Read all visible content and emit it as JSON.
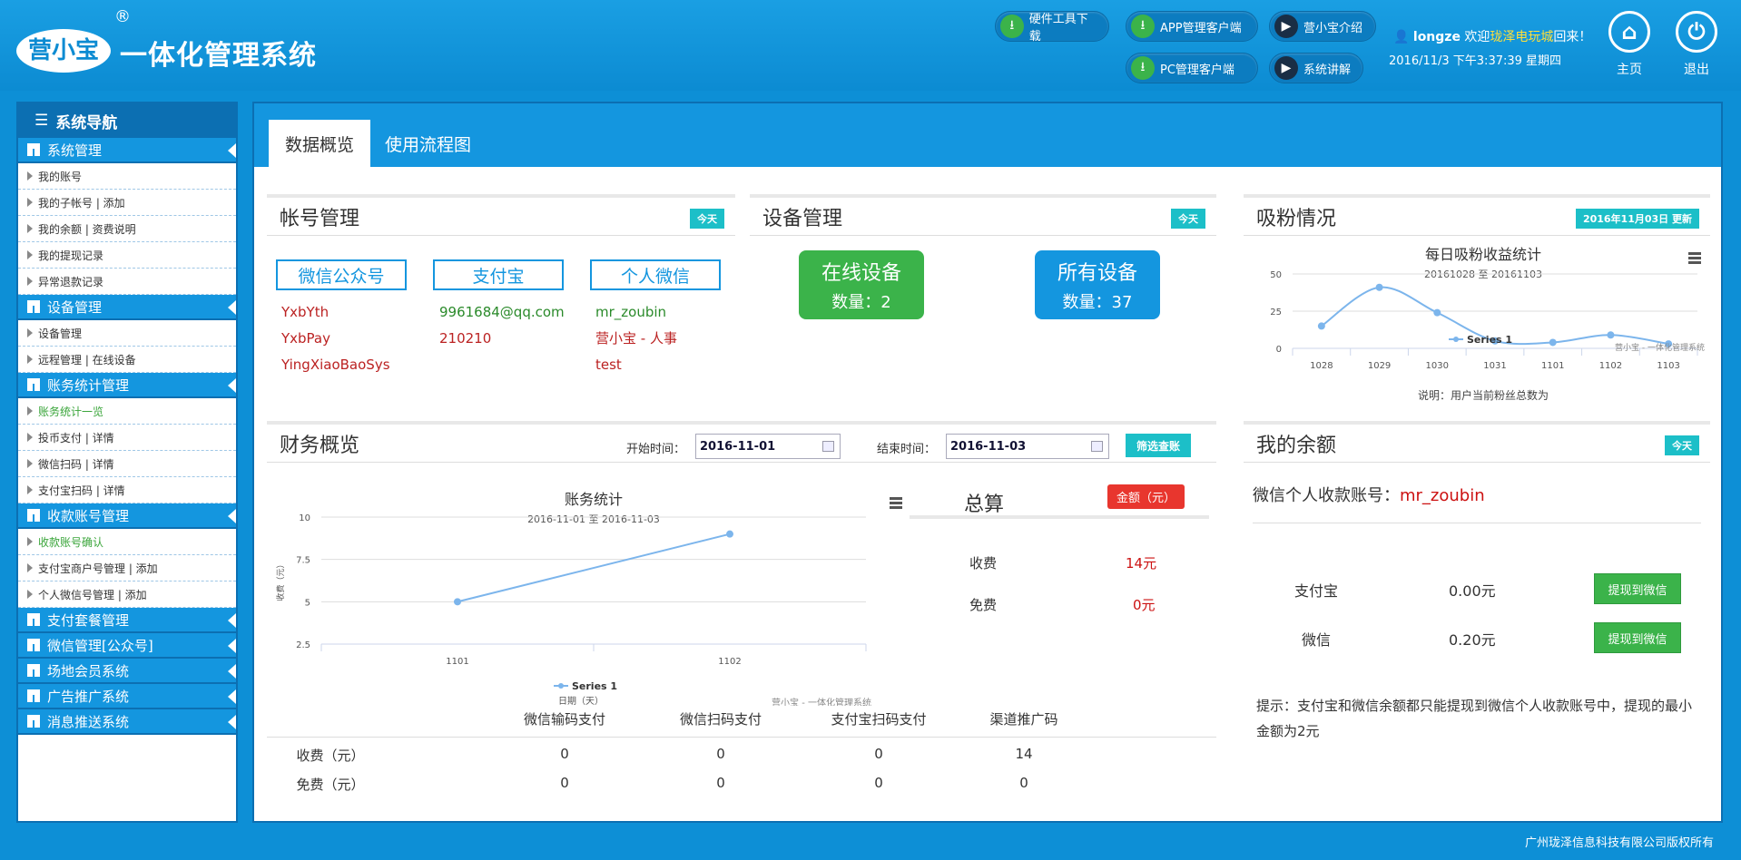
{
  "header": {
    "logo_text": "营小宝",
    "registered_mark": "®",
    "app_title": "一体化管理系统",
    "buttons": [
      {
        "label": "硬件工具下载",
        "icon": "download-icon"
      },
      {
        "label": "APP管理客户端",
        "icon": "download-icon"
      },
      {
        "label": "营小宝介绍",
        "icon": "play-icon"
      },
      {
        "label": "PC管理客户端",
        "icon": "download-icon"
      },
      {
        "label": "系统讲解",
        "icon": "play-icon"
      }
    ],
    "username": "longze",
    "welcome_prefix": "欢迎",
    "shop_name": "珑泽电玩城",
    "welcome_suffix": "回来！",
    "datetime": "2016/11/3 下午3:37:39 星期四",
    "home_label": "主页",
    "logout_label": "退出"
  },
  "sidebar": {
    "title": "系统导航",
    "sections": [
      {
        "label": "系统管理",
        "items": [
          "我的账号",
          "我的子帐号 | 添加",
          "我的余额 | 资费说明",
          "我的提现记录",
          "异常退款记录"
        ]
      },
      {
        "label": "设备管理",
        "items": [
          "设备管理",
          "远程管理 | 在线设备"
        ]
      },
      {
        "label": "账务统计管理",
        "items": [
          "账务统计一览",
          "投币支付 | 详情",
          "微信扫码 | 详情",
          "支付宝扫码 | 详情"
        ]
      },
      {
        "label": "收款账号管理",
        "items": [
          "收款账号确认",
          "支付宝商户号管理 | 添加",
          "个人微信号管理 | 添加"
        ]
      },
      {
        "label": "支付套餐管理",
        "items": []
      },
      {
        "label": "微信管理[公众号]",
        "items": []
      },
      {
        "label": "场地会员系统",
        "items": []
      },
      {
        "label": "广告推广系统",
        "items": []
      },
      {
        "label": "消息推送系统",
        "items": []
      }
    ]
  },
  "tabs": [
    "数据概览",
    "使用流程图"
  ],
  "account_panel": {
    "title": "帐号管理",
    "badge": "今天",
    "columns": [
      "微信公众号",
      "支付宝",
      "个人微信"
    ],
    "wechat_public": [
      "YxbYth",
      "YxbPay",
      "YingXiaoBaoSys"
    ],
    "alipay": [
      "9961684@qq.com",
      "210210"
    ],
    "personal_wechat": [
      "mr_zoubin",
      "营小宝 - 人事",
      "test"
    ]
  },
  "device_panel": {
    "title": "设备管理",
    "badge": "今天",
    "online_label": "在线设备",
    "online_count": "数量：2",
    "all_label": "所有设备",
    "all_count": "数量：37"
  },
  "fans_panel": {
    "title": "吸粉情况",
    "badge": "2016年11月03日 更新",
    "chart_title": "每日吸粉收益统计",
    "chart_subtitle": "20161028 至 20161103",
    "credit": "营小宝 - 一体化管理系统",
    "note": "说明：用户当前粉丝总数为"
  },
  "finance_panel": {
    "title": "财务概览",
    "start_label": "开始时间：",
    "start_value": "2016-11-01",
    "end_label": "结束时间：",
    "end_value": "2016-11-03",
    "filter_button": "筛选查账",
    "chart_title": "账务统计",
    "chart_subtitle": "2016-11-01 至 2016-11-03",
    "credit": "营小宝 - 一体化管理系统",
    "summary_title": "总算",
    "amount_badge": "金额（元）",
    "charge_label": "收费",
    "charge_value": "14元",
    "free_label": "免费",
    "free_value": "0元",
    "table": {
      "headers": [
        "",
        "微信输码支付",
        "微信扫码支付",
        "支付宝扫码支付",
        "渠道推广码"
      ],
      "rows": [
        [
          "收费（元）",
          "0",
          "0",
          "0",
          "14"
        ],
        [
          "免费（元）",
          "0",
          "0",
          "0",
          "0"
        ]
      ]
    }
  },
  "balance_panel": {
    "title": "我的余额",
    "badge": "今天",
    "account_label": "微信个人收款账号：",
    "account_value": "mr_zoubin",
    "rows": [
      {
        "label": "支付宝",
        "value": "0.00元",
        "button": "提现到微信"
      },
      {
        "label": "微信",
        "value": "0.20元",
        "button": "提现到微信"
      }
    ],
    "tip": "提示：支付宝和微信余额都只能提现到微信个人收款账号中，提现的最小金额为2元"
  },
  "footer": "广州珑泽信息科技有限公司版权所有",
  "chart_data": [
    {
      "type": "line",
      "title": "每日吸粉收益统计",
      "subtitle": "20161028 至 20161103",
      "categories": [
        "1028",
        "1029",
        "1030",
        "1031",
        "1101",
        "1102",
        "1103"
      ],
      "series": [
        {
          "name": "Series 1",
          "values": [
            15,
            41,
            24,
            5,
            4,
            9,
            3
          ]
        }
      ],
      "ylim": [
        0,
        50
      ],
      "yticks": [
        0,
        25,
        50
      ],
      "color": "#7cb5ec"
    },
    {
      "type": "line",
      "title": "账务统计",
      "subtitle": "2016-11-01 至 2016-11-03",
      "categories": [
        "1101",
        "1102"
      ],
      "series": [
        {
          "name": "Series 1",
          "values": [
            5,
            9
          ]
        }
      ],
      "xlabel": "日期（天）",
      "ylabel": "收费（元）",
      "ylim": [
        2.5,
        10
      ],
      "yticks": [
        2.5,
        5,
        7.5,
        10
      ],
      "color": "#7cb5ec"
    }
  ]
}
